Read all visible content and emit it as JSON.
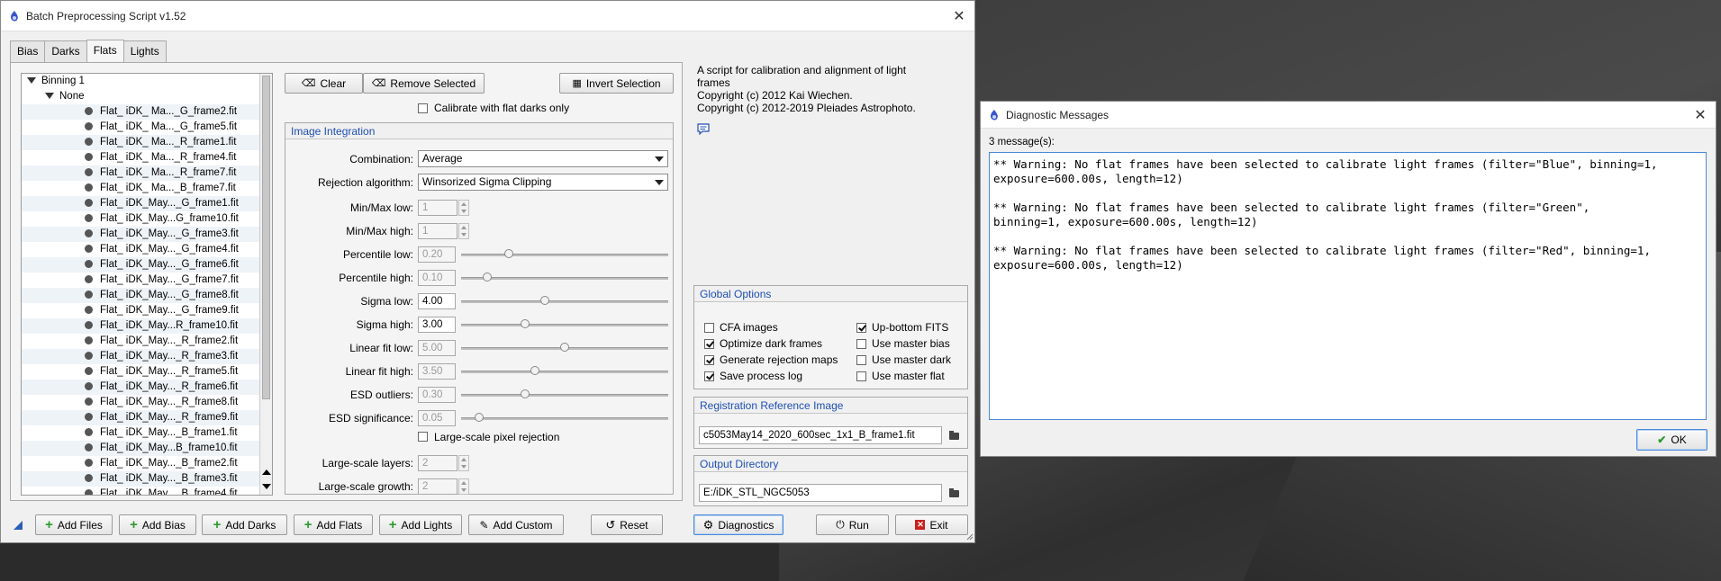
{
  "main_window": {
    "title": "Batch Preprocessing Script v1.52",
    "close_glyph": "✕",
    "tabs": [
      {
        "label": "Bias"
      },
      {
        "label": "Darks"
      },
      {
        "label": "Flats",
        "active": true
      },
      {
        "label": "Lights"
      }
    ],
    "tree": {
      "root": "Binning 1",
      "group": "None",
      "files": [
        "Flat_ iDK_ Ma..._G_frame2.fit",
        "Flat_ iDK_ Ma..._G_frame5.fit",
        "Flat_ iDK_ Ma..._R_frame1.fit",
        "Flat_ iDK_ Ma..._R_frame4.fit",
        "Flat_ iDK_ Ma..._R_frame7.fit",
        "Flat_ iDK_ Ma..._B_frame7.fit",
        "Flat_ iDK_May..._G_frame1.fit",
        "Flat_ iDK_May...G_frame10.fit",
        "Flat_ iDK_May..._G_frame3.fit",
        "Flat_ iDK_May..._G_frame4.fit",
        "Flat_ iDK_May..._G_frame6.fit",
        "Flat_ iDK_May..._G_frame7.fit",
        "Flat_ iDK_May..._G_frame8.fit",
        "Flat_ iDK_May..._G_frame9.fit",
        "Flat_ iDK_May...R_frame10.fit",
        "Flat_ iDK_May..._R_frame2.fit",
        "Flat_ iDK_May..._R_frame3.fit",
        "Flat_ iDK_May..._R_frame5.fit",
        "Flat_ iDK_May..._R_frame6.fit",
        "Flat_ iDK_May..._R_frame8.fit",
        "Flat_ iDK_May..._R_frame9.fit",
        "Flat_ iDK_May..._B_frame1.fit",
        "Flat_ iDK_May...B_frame10.fit",
        "Flat_ iDK_May..._B_frame2.fit",
        "Flat_ iDK_May..._B_frame3.fit",
        "Flat_ iDK_May..._B_frame4.fit"
      ]
    },
    "buttons": {
      "clear": "Clear",
      "remove_selected": "Remove Selected",
      "invert_selection": "Invert Selection"
    },
    "calibrate_flat_darks": {
      "label": "Calibrate with flat darks only",
      "checked": false
    },
    "image_integration": {
      "title": "Image Integration",
      "combination_label": "Combination:",
      "combination_value": "Average",
      "rejection_label": "Rejection algorithm:",
      "rejection_value": "Winsorized Sigma Clipping",
      "minmax_low_label": "Min/Max low:",
      "minmax_low": "1",
      "minmax_high_label": "Min/Max high:",
      "minmax_high": "1",
      "percentile_low_label": "Percentile low:",
      "percentile_low": "0.20",
      "percentile_high_label": "Percentile high:",
      "percentile_high": "0.10",
      "sigma_low_label": "Sigma low:",
      "sigma_low": "4.00",
      "sigma_high_label": "Sigma high:",
      "sigma_high": "3.00",
      "linear_fit_low_label": "Linear fit low:",
      "linear_fit_low": "5.00",
      "linear_fit_high_label": "Linear fit high:",
      "linear_fit_high": "3.50",
      "esd_outliers_label": "ESD outliers:",
      "esd_outliers": "0.30",
      "esd_significance_label": "ESD significance:",
      "esd_significance": "0.05",
      "large_scale_label": "Large-scale pixel rejection",
      "large_scale_checked": false,
      "large_scale_layers_label": "Large-scale layers:",
      "large_scale_layers": "2",
      "large_scale_growth_label": "Large-scale growth:",
      "large_scale_growth": "2",
      "slider_fraction": {
        "percentile_low": 0.22,
        "percentile_high": 0.11,
        "sigma_low": 0.4,
        "sigma_high": 0.3,
        "linear_fit_low": 0.5,
        "linear_fit_high": 0.35,
        "esd_outliers": 0.3,
        "esd_significance": 0.07
      }
    },
    "info": {
      "line1": "A script for calibration and alignment of light",
      "line2": "frames",
      "line3": "Copyright (c) 2012 Kai Wiechen.",
      "line4": "Copyright (c) 2012-2019 Pleiades Astrophoto."
    },
    "global_options": {
      "title": "Global Options",
      "cfa_images": {
        "label": "CFA images",
        "checked": false
      },
      "optimize_dark": {
        "label": "Optimize dark frames",
        "checked": true
      },
      "gen_rejection": {
        "label": "Generate rejection maps",
        "checked": true
      },
      "save_log": {
        "label": "Save process log",
        "checked": true
      },
      "up_bottom": {
        "label": "Up-bottom FITS",
        "checked": true
      },
      "master_bias": {
        "label": "Use master bias",
        "checked": false
      },
      "master_dark": {
        "label": "Use master dark",
        "checked": false
      },
      "master_flat": {
        "label": "Use master flat",
        "checked": false
      }
    },
    "registration": {
      "title": "Registration Reference Image",
      "value": "c5053May14_2020_600sec_1x1_B_frame1.fit"
    },
    "output": {
      "title": "Output Directory",
      "value": "E:/iDK_STL_NGC5053"
    },
    "bottom_bar": {
      "add_files": "Add Files",
      "add_bias": "Add Bias",
      "add_darks": "Add Darks",
      "add_flats": "Add Flats",
      "add_lights": "Add Lights",
      "add_custom": "Add Custom",
      "reset": "Reset",
      "diagnostics": "Diagnostics",
      "run": "Run",
      "exit": "Exit"
    }
  },
  "diagnostic_window": {
    "title": "Diagnostic Messages",
    "close_glyph": "✕",
    "count": "3 message(s):",
    "messages": [
      {
        "l1": "** Warning: No flat frames have been selected to calibrate light frames (filter=\"Blue\", binning=1,",
        "l2": "exposure=600.00s, length=12)"
      },
      {
        "l1": "** Warning: No flat frames have been selected to calibrate light frames (filter=\"Green\",",
        "l2": "binning=1, exposure=600.00s, length=12)"
      },
      {
        "l1": "** Warning: No flat frames have been selected to calibrate light frames (filter=\"Red\", binning=1,",
        "l2": "exposure=600.00s, length=12)"
      }
    ],
    "ok": "OK"
  },
  "colors": {
    "section_title": "#1f4fb4",
    "add_plus": "#2e9a2e",
    "exit_red": "#c8201c"
  }
}
